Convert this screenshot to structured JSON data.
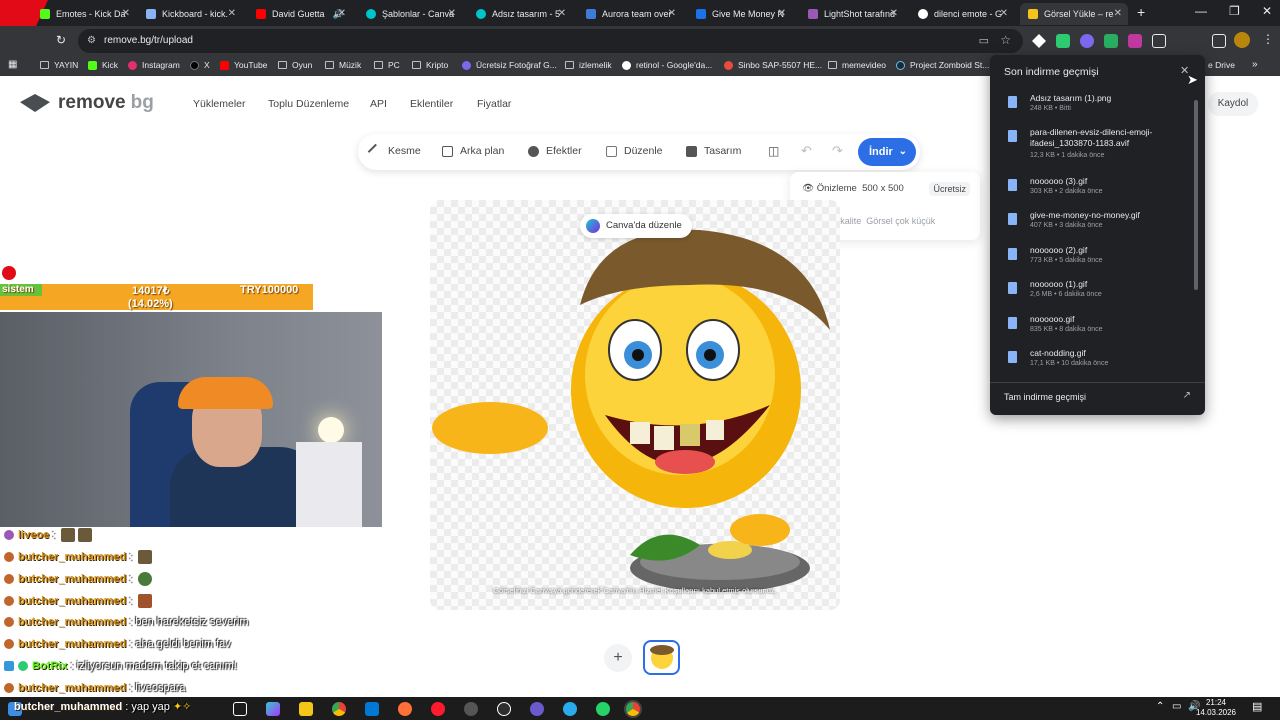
{
  "browser": {
    "tabs": [
      {
        "label": "Emotes - Kick Da",
        "color": "#53fc18"
      },
      {
        "label": "Kickboard - kick.",
        "color": "#8ab4f8"
      },
      {
        "label": "David Guetta",
        "color": "#ff0000"
      },
      {
        "label": "Şablonlar - Canva",
        "color": "#00c4cc"
      },
      {
        "label": "Adsız tasarım - 5",
        "color": "#00c4cc"
      },
      {
        "label": "Aurora team over",
        "color": "#3b7dd8"
      },
      {
        "label": "Give Me Money N",
        "color": "#1a73e8"
      },
      {
        "label": "LightShot tarafınd",
        "color": "#9b59b6"
      },
      {
        "label": "dilenci emote - G",
        "color": "#ffffff"
      },
      {
        "label": "Görsel Yükle – re",
        "color": "#f5c518"
      }
    ],
    "url": "remove.bg/tr/upload",
    "bookmarks": [
      "YAYIN",
      "Kick",
      "Instagram",
      "X",
      "YouTube",
      "Oyun",
      "Müzik",
      "PC",
      "Kripto",
      "Ücretsiz Fotoğraf G...",
      "izlemelik",
      "retinol - Google'da...",
      "Sinbo SAP-5507 HE...",
      "memevideo",
      "Project Zomboid St...",
      "e Drive"
    ]
  },
  "site": {
    "logo_main": "remove",
    "logo_suffix": "bg",
    "nav": [
      "Yüklemeler",
      "Toplu Düzenleme",
      "API",
      "Eklentiler",
      "Fiyatlar"
    ],
    "signup": "Kaydol",
    "tools": [
      "Kesme",
      "Arka plan",
      "Efektler",
      "Düzenle",
      "Tasarım"
    ],
    "download_label": "İndir",
    "preview_label": "Önizleme",
    "preview_size": "500 x 500",
    "preview_badge": "Ücretsiz",
    "best_quality": "En iyi kalite",
    "best_quality_note": "Görsel çok küçük",
    "canva_button": "Canva'da düzenle",
    "terms": "Görselinizi Canva'ya göndererek Canva'nın Hizmet Koşullarını kabul etmiş olursunuz."
  },
  "downloads": {
    "title": "Son indirme geçmişi",
    "items": [
      {
        "name": "Adsız tasarım (1).png",
        "meta": "248 KB • Bitti"
      },
      {
        "name": "para-dilenen-evsiz-dilenci-emoji-ifadesi_1303870-1183.avif",
        "meta": "12,3 KB • 1 dakika önce"
      },
      {
        "name": "noooooo (3).gif",
        "meta": "303 KB • 2 dakika önce"
      },
      {
        "name": "give-me-money-no-money.gif",
        "meta": "407 KB • 3 dakika önce"
      },
      {
        "name": "noooooo (2).gif",
        "meta": "773 KB • 5 dakika önce"
      },
      {
        "name": "noooooo (1).gif",
        "meta": "2,6 MB • 6 dakika önce"
      },
      {
        "name": "noooooo.gif",
        "meta": "835 KB • 8 dakika önce"
      },
      {
        "name": "cat-nodding.gif",
        "meta": "17,1 KB • 10 dakika önce"
      }
    ],
    "footer": "Tam indirme geçmişi"
  },
  "stream": {
    "goal_label": "sistem",
    "goal_value": "14017₺",
    "goal_percent": "(14.02%)",
    "goal_target": "TRY100000",
    "goal_progress": 0.1402,
    "chat": [
      {
        "user": "liveoe",
        "msg": ""
      },
      {
        "user": "butcher_muhammed",
        "msg": ""
      },
      {
        "user": "butcher_muhammed",
        "msg": ""
      },
      {
        "user": "butcher_muhammed",
        "msg": ""
      },
      {
        "user": "butcher_muhammed",
        "msg": "ben hareketsiz severim"
      },
      {
        "user": "butcher_muhammed",
        "msg": "aha geldi benim fav"
      },
      {
        "user": "BotRix",
        "msg": "izliyorsun madem takip et canım!"
      },
      {
        "user": "butcher_muhammed",
        "msg": "liveospara"
      },
      {
        "user": "butcher_muhammed",
        "msg": "yap yap"
      }
    ]
  },
  "taskbar": {
    "time": "21:24",
    "date": "14.03.2026"
  },
  "colors": {
    "accent": "#2b6ee5",
    "dark": "#202124",
    "goal": "#f5a623"
  }
}
